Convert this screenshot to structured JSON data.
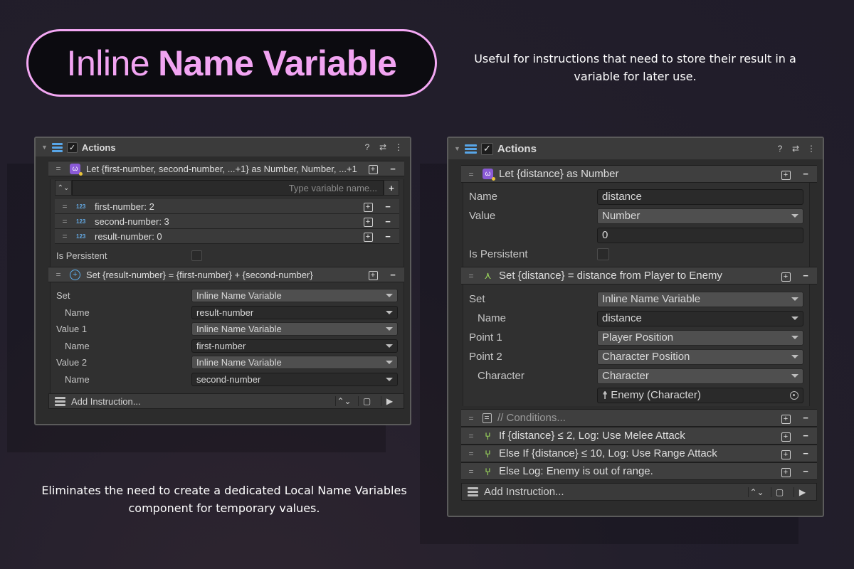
{
  "hero": {
    "title_light": "Inline",
    "title_bold": "Name Variable"
  },
  "captions": {
    "top": "Useful for instructions that need to store their result in a variable for later use.",
    "bottom": "Eliminates the need to create a dedicated Local Name Variables component for temporary values."
  },
  "left_panel": {
    "header": {
      "title": "Actions"
    },
    "let_instruction": "Let {first-number, second-number, ...+1} as Number, Number, ...+1",
    "search_placeholder": "Type variable name...",
    "variables": [
      {
        "badge": "123",
        "label": "first-number: 2"
      },
      {
        "badge": "123",
        "label": "second-number: 3"
      },
      {
        "badge": "123",
        "label": "result-number: 0"
      }
    ],
    "is_persistent_label": "Is Persistent",
    "set_instruction": "Set {result-number} = {first-number} + {second-number}",
    "set_props": [
      {
        "label": "Set",
        "value": "Inline Name Variable",
        "kind": "dropdown",
        "indent": false
      },
      {
        "label": "Name",
        "value": "result-number",
        "kind": "field",
        "indent": true
      },
      {
        "label": "Value 1",
        "value": "Inline Name Variable",
        "kind": "dropdown",
        "indent": false
      },
      {
        "label": "Name",
        "value": "first-number",
        "kind": "field",
        "indent": true
      },
      {
        "label": "Value 2",
        "value": "Inline Name Variable",
        "kind": "dropdown",
        "indent": false
      },
      {
        "label": "Name",
        "value": "second-number",
        "kind": "field",
        "indent": true
      }
    ],
    "footer_label": "Add Instruction..."
  },
  "right_panel": {
    "header": {
      "title": "Actions"
    },
    "let_instruction": "Let {distance} as Number",
    "let_props": {
      "name_label": "Name",
      "name_value": "distance",
      "value_label": "Value",
      "value_type": "Number",
      "value_number": "0",
      "is_persistent_label": "Is Persistent"
    },
    "set_instruction": "Set {distance} = distance from Player to Enemy",
    "set_props": [
      {
        "label": "Set",
        "value": "Inline Name Variable",
        "kind": "dropdown",
        "indent": false
      },
      {
        "label": "Name",
        "value": "distance",
        "kind": "field",
        "indent": true
      },
      {
        "label": "Point 1",
        "value": "Player Position",
        "kind": "dropdown",
        "indent": false
      },
      {
        "label": "Point 2",
        "value": "Character Position",
        "kind": "dropdown",
        "indent": false
      },
      {
        "label": "Character",
        "value": "Character",
        "kind": "dropdown",
        "indent": true
      }
    ],
    "character_object": "Enemy (Character)",
    "conditions": [
      {
        "icon": "note-icon",
        "label": "// Conditions..."
      },
      {
        "icon": "branch-icon",
        "label": "If {distance} ≤ 2, Log: Use Melee Attack"
      },
      {
        "icon": "branch-icon",
        "label": "Else If {distance} ≤ 10, Log: Use Range Attack"
      },
      {
        "icon": "branch-icon",
        "label": "Else Log: Enemy is out of range."
      }
    ],
    "footer_label": "Add Instruction..."
  },
  "colors": {
    "accent_pink": "#f4a8f4",
    "panel_bg": "#2c2c2c",
    "blue_icon": "#58a6e8",
    "green_icon": "#9ad45c"
  }
}
